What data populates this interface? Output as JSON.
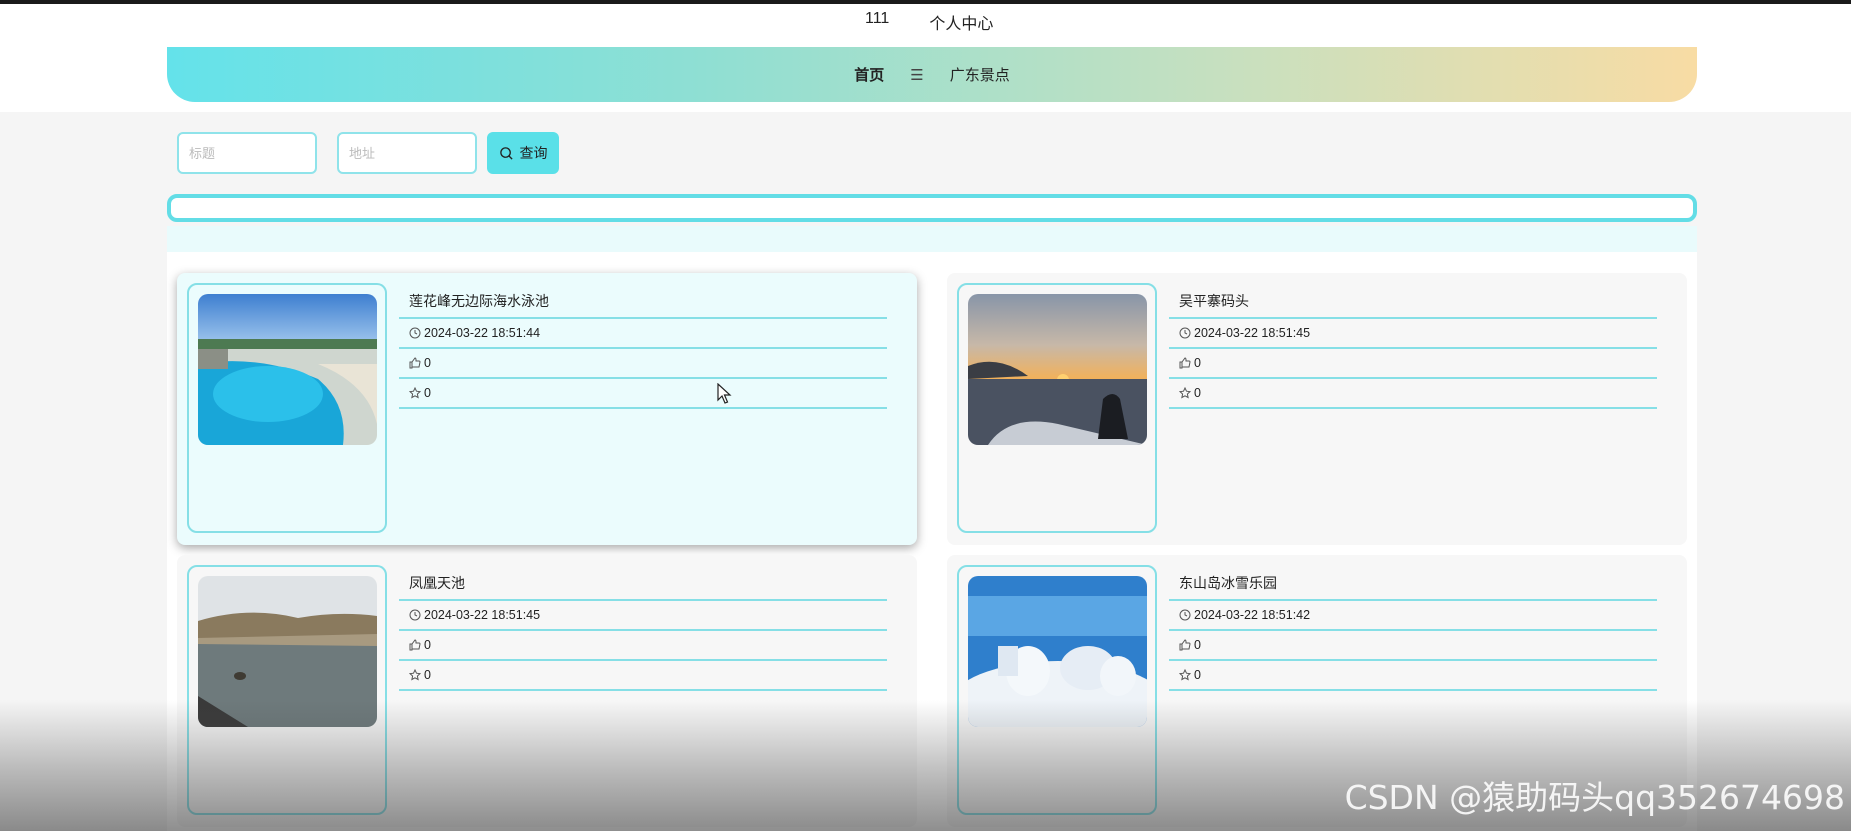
{
  "header": {
    "username": "111",
    "personal_center": "个人中心"
  },
  "nav": {
    "home": "首页",
    "menu_icon": "☰",
    "scenic": "广东景点"
  },
  "search": {
    "title_placeholder": "标题",
    "address_placeholder": "地址",
    "button_label": "查询"
  },
  "cards": [
    {
      "title": "莲花峰无边际海水泳池",
      "time": "2024-03-22 18:51:44",
      "likes": "0",
      "favorites": "0",
      "image": "pool-photo"
    },
    {
      "title": "吴平寨码头",
      "time": "2024-03-22 18:51:45",
      "likes": "0",
      "favorites": "0",
      "image": "sunset-pier-photo"
    },
    {
      "title": "凤凰天池",
      "time": "2024-03-22 18:51:45",
      "likes": "0",
      "favorites": "0",
      "image": "lake-photo"
    },
    {
      "title": "东山岛冰雪乐园",
      "time": "2024-03-22 18:51:42",
      "likes": "0",
      "favorites": "0",
      "image": "snow-park-photo"
    }
  ],
  "watermark": "CSDN @猿助码头qq352674698",
  "colors": {
    "accent": "#5ae0e8",
    "border": "#86dfe6",
    "gradient_start": "#64e2ea",
    "gradient_end": "#f8dca4"
  }
}
